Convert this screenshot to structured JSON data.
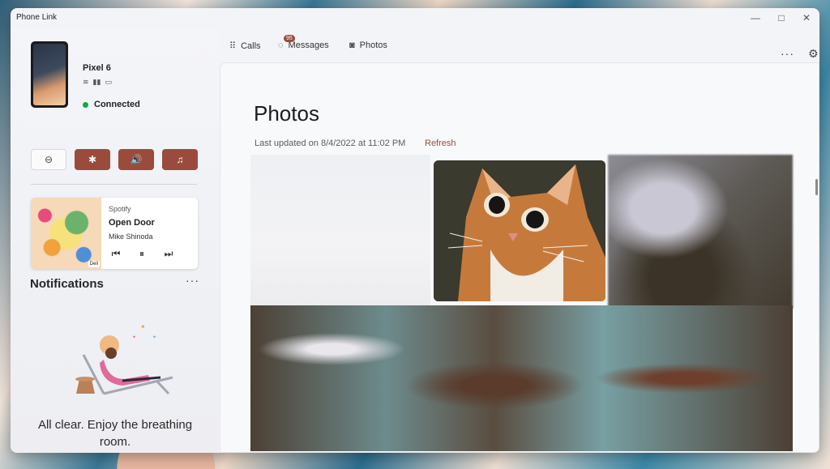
{
  "window": {
    "title": "Phone Link",
    "controls": [
      "—",
      "□",
      "✕"
    ]
  },
  "device": {
    "name": "Pixel 6",
    "status": "Connected",
    "icons": [
      "wifi-icon",
      "signal-icon",
      "battery-icon"
    ]
  },
  "quick_actions": [
    {
      "name": "do-not-disturb",
      "icon": "⊖"
    },
    {
      "name": "bluetooth",
      "icon": "✱"
    },
    {
      "name": "volume",
      "icon": "🔊"
    },
    {
      "name": "music",
      "icon": "♫"
    }
  ],
  "media": {
    "source": "Spotify",
    "title": "Open Door",
    "artist": "Mike Shinoda",
    "album_badge": "Dell",
    "controls": [
      "⏮",
      "⏸",
      "⏭"
    ]
  },
  "notifications": {
    "title": "Notifications",
    "more": "···",
    "empty_message": "All clear. Enjoy the breathing room."
  },
  "nav": {
    "calls": "Calls",
    "messages": "Messages",
    "messages_badge": "95",
    "photos": "Photos",
    "more": "···",
    "settings_icon": "⚙"
  },
  "photos": {
    "title": "Photos",
    "last_updated": "Last updated on 8/4/2022 at 11:02 PM",
    "refresh": "Refresh"
  },
  "colors": {
    "accent": "#9a4b3c",
    "connected": "#12a64a"
  }
}
